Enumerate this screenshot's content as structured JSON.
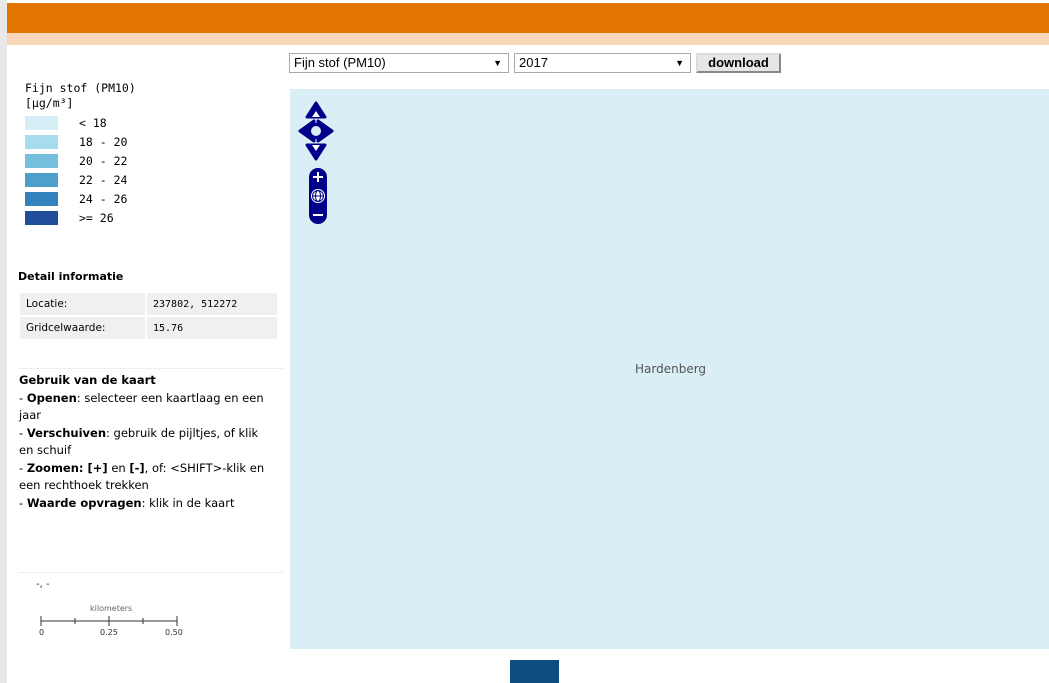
{
  "layer_select": {
    "value": "Fijn stof (PM10)"
  },
  "year_select": {
    "value": "2017"
  },
  "download_label": "download",
  "legend": {
    "title_line1": "Fijn stof (PM10)",
    "title_line2": "[µg/m³]",
    "items": [
      {
        "label": "< 18",
        "color": "#d6eff7"
      },
      {
        "label": "18 - 20",
        "color": "#a6dcee"
      },
      {
        "label": "20 - 22",
        "color": "#74c0dc"
      },
      {
        "label": "22 - 24",
        "color": "#4f9fcb"
      },
      {
        "label": "24 - 26",
        "color": "#3382bd"
      },
      {
        "label": ">= 26",
        "color": "#1f4e9c"
      }
    ]
  },
  "detail": {
    "title": "Detail informatie",
    "rows": [
      {
        "label": "Locatie:",
        "value": "237802, 512272"
      },
      {
        "label": "Gridcelwaarde:",
        "value": "15.76"
      }
    ]
  },
  "usage": {
    "title": "Gebruik van de kaart",
    "lines": [
      {
        "prefix": "- ",
        "bold": "Openen",
        "rest": ": selecteer een kaartlaag en een jaar"
      },
      {
        "prefix": "- ",
        "bold": "Verschuiven",
        "rest": ": gebruik de pijltjes, of klik en schuif"
      },
      {
        "prefix": "- ",
        "bold": "Zoomen",
        "rest": " en , of: <SHIFT>-klik en een rechthoek trekken"
      },
      {
        "prefix": "- ",
        "bold": "Waarde opvragen",
        "rest": ": klik in de kaart"
      }
    ],
    "zoom_in_key": "[+]",
    "zoom_out_key": "[-]",
    "zoom_colon": ": "
  },
  "coords": "-, -",
  "scale": {
    "unit": "kilometers",
    "ticks": [
      "0",
      "0.25",
      "0.50"
    ]
  },
  "map": {
    "place_label": "Hardenberg",
    "background": "#d9eef5"
  },
  "colors": {
    "header": "#e37400",
    "header_sub": "#f7d7b7",
    "control": "#00008b",
    "footer_block": "#0f4c81"
  }
}
